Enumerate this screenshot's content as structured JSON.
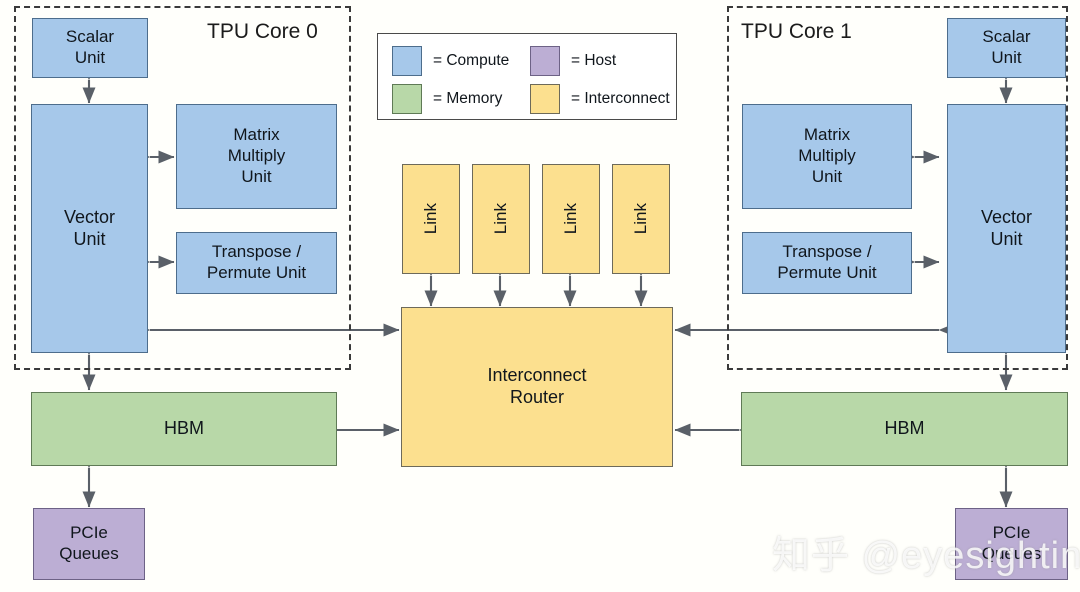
{
  "cores": [
    {
      "title": "TPU Core 0",
      "blocks": {
        "scalar": "Scalar\nUnit",
        "vector": "Vector\nUnit",
        "matrix": "Matrix\nMultiply\nUnit",
        "transpose": "Transpose /\nPermute Unit"
      },
      "hbm": "HBM",
      "pcie": "PCIe\nQueues"
    },
    {
      "title": "TPU Core 1",
      "blocks": {
        "scalar": "Scalar\nUnit",
        "vector": "Vector\nUnit",
        "matrix": "Matrix\nMultiply\nUnit",
        "transpose": "Transpose /\nPermute Unit"
      },
      "hbm": "HBM",
      "pcie": "PCIe\nQueues"
    }
  ],
  "legend": {
    "items": [
      {
        "label": "= Compute",
        "color": "#a6c8ea",
        "category": "compute"
      },
      {
        "label": "= Host",
        "color": "#bcaed4",
        "category": "host"
      },
      {
        "label": "= Memory",
        "color": "#b8d8a8",
        "category": "memory"
      },
      {
        "label": "= Interconnect",
        "color": "#fce08f",
        "category": "interconnect"
      }
    ]
  },
  "interconnect": {
    "router": "Interconnect\nRouter",
    "links": [
      "Link",
      "Link",
      "Link",
      "Link"
    ]
  },
  "watermark": "知乎 @eyesighting",
  "colors": {
    "compute": "#a6c8ea",
    "memory": "#b8d8a8",
    "host": "#bcaed4",
    "interconnect": "#fce08f",
    "wire": "#5a6068",
    "frame_dash": "#3a3a3a",
    "background": "#fffffb"
  }
}
